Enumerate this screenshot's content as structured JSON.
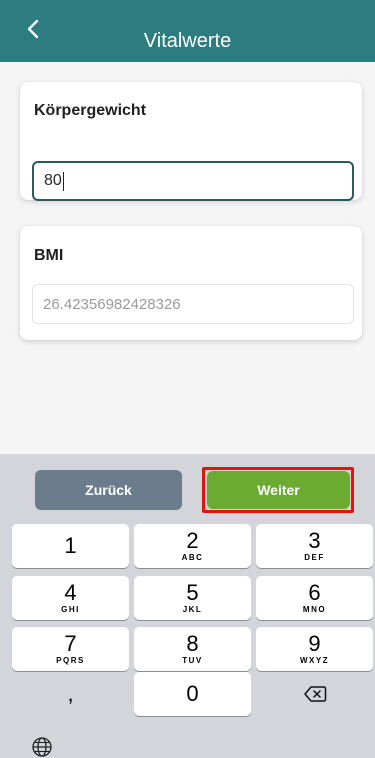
{
  "header": {
    "title": "Vitalwerte"
  },
  "weight": {
    "label": "Körpergewicht",
    "value": "80"
  },
  "bmi": {
    "label": "BMI",
    "value": "26.42356982428326"
  },
  "actions": {
    "back_label": "Zurück",
    "next_label": "Weiter"
  },
  "keypad": [
    {
      "digit": "1",
      "letters": ""
    },
    {
      "digit": "2",
      "letters": "ABC"
    },
    {
      "digit": "3",
      "letters": "DEF"
    },
    {
      "digit": "4",
      "letters": "GHI"
    },
    {
      "digit": "5",
      "letters": "JKL"
    },
    {
      "digit": "6",
      "letters": "MNO"
    },
    {
      "digit": "7",
      "letters": "PQRS"
    },
    {
      "digit": "8",
      "letters": "TUV"
    },
    {
      "digit": "9",
      "letters": "WXYZ"
    },
    {
      "digit": ",",
      "letters": ""
    },
    {
      "digit": "0",
      "letters": ""
    }
  ],
  "colors": {
    "header": "#2d7c7f",
    "back_button": "#6b7d8c",
    "next_button": "#6bab31",
    "highlight": "#e3120b"
  },
  "icons": [
    "chevron-left-icon",
    "backspace-icon",
    "globe-icon"
  ]
}
